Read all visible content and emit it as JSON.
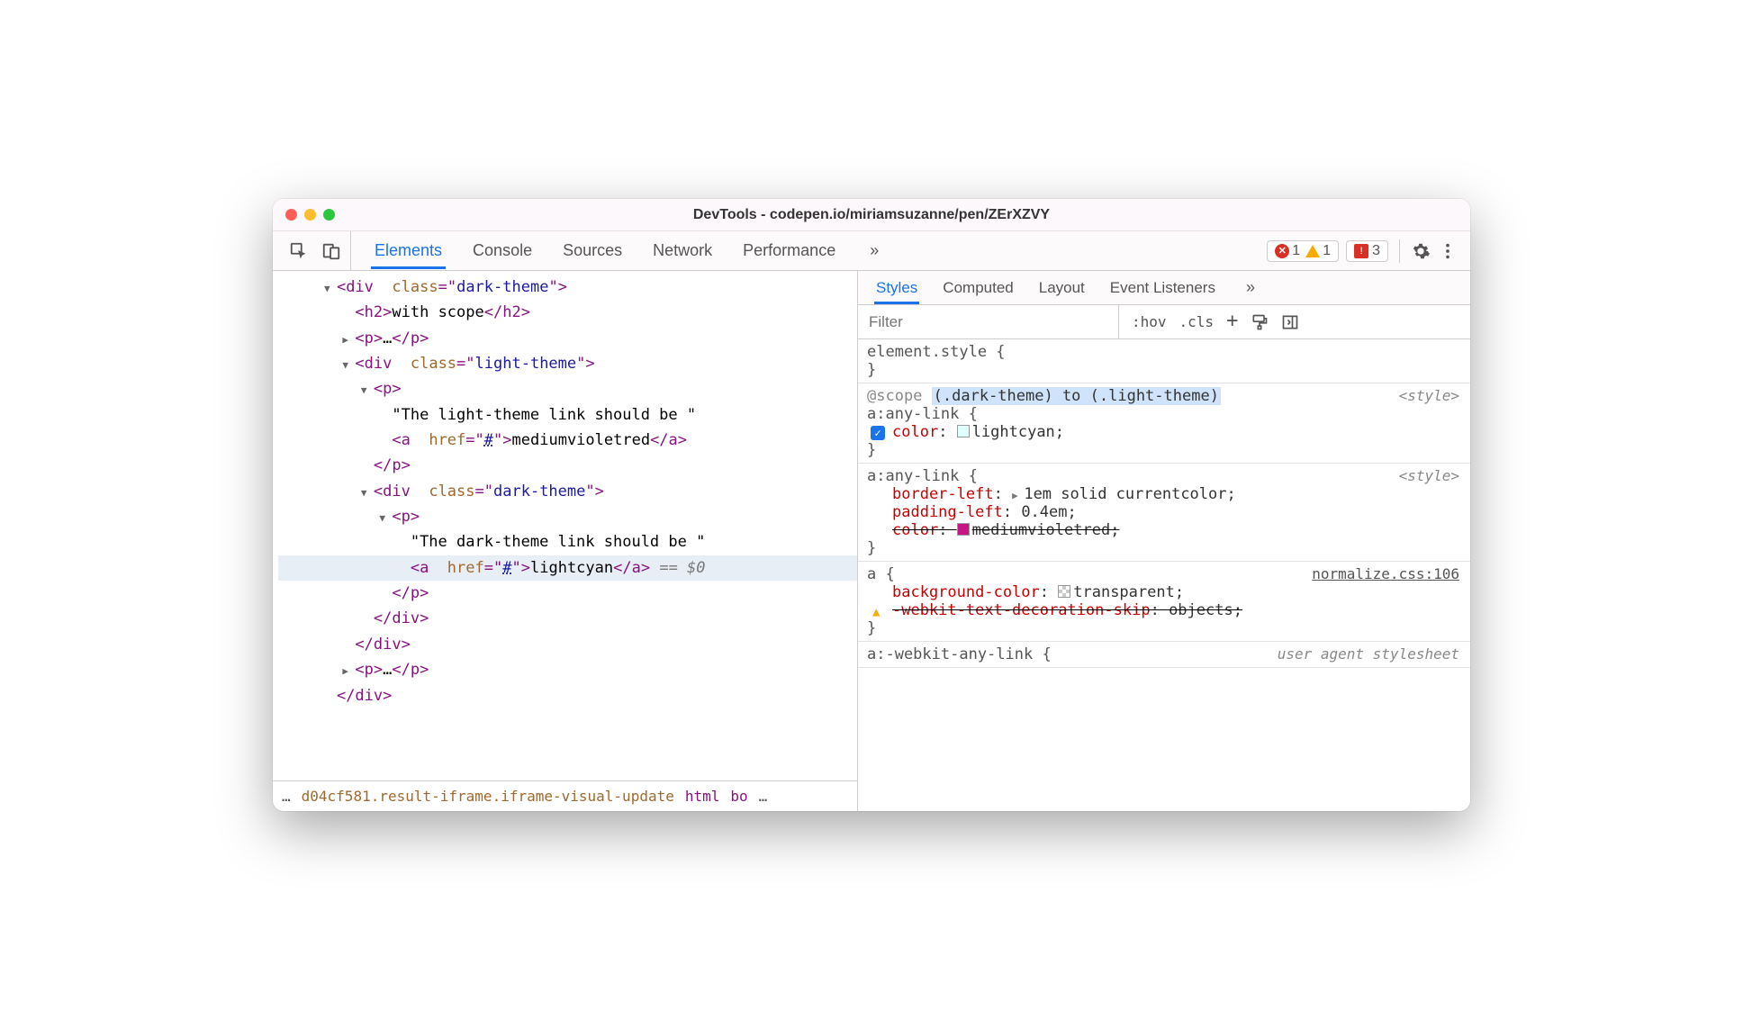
{
  "window": {
    "title": "DevTools - codepen.io/miriamsuzanne/pen/ZErXZVY"
  },
  "toolbar": {
    "tabs": [
      "Elements",
      "Console",
      "Sources",
      "Network",
      "Performance"
    ],
    "activeTab": "Elements",
    "more": "»",
    "errors": "1",
    "warnings": "1",
    "issues": "3"
  },
  "dom": {
    "lines": [
      {
        "indent": 2,
        "tri": "open",
        "html": "<div class=\"dark-theme\">"
      },
      {
        "indent": 3,
        "tri": "",
        "html": "<h2>with scope</h2>"
      },
      {
        "indent": 3,
        "tri": "closed",
        "html": "<p>…</p>"
      },
      {
        "indent": 3,
        "tri": "open",
        "html": "<div class=\"light-theme\">"
      },
      {
        "indent": 4,
        "tri": "open",
        "html": "<p>"
      },
      {
        "indent": 5,
        "tri": "",
        "text": "\"The light-theme link should be \""
      },
      {
        "indent": 5,
        "tri": "",
        "html": "<a href=\"#\">mediumvioletred</a>"
      },
      {
        "indent": 4,
        "tri": "",
        "html": "</p>"
      },
      {
        "indent": 4,
        "tri": "open",
        "html": "<div class=\"dark-theme\">"
      },
      {
        "indent": 5,
        "tri": "open",
        "html": "<p>"
      },
      {
        "indent": 6,
        "tri": "",
        "text": "\"The dark-theme link should be \""
      },
      {
        "indent": 6,
        "tri": "",
        "selected": true,
        "html": "<a href=\"#\">lightcyan</a>",
        "suffix": " == $0"
      },
      {
        "indent": 5,
        "tri": "",
        "html": "</p>"
      },
      {
        "indent": 4,
        "tri": "",
        "html": "</div>"
      },
      {
        "indent": 3,
        "tri": "",
        "html": "</div>"
      },
      {
        "indent": 3,
        "tri": "closed",
        "html": "<p>…</p>"
      },
      {
        "indent": 2,
        "tri": "",
        "html": "</div>"
      }
    ]
  },
  "breadcrumb": {
    "ellipsis": "…",
    "id": "d04cf581.result-iframe.iframe-visual-update",
    "items": [
      "html",
      "bo"
    ],
    "trailing": "…"
  },
  "sidebar": {
    "tabs": [
      "Styles",
      "Computed",
      "Layout",
      "Event Listeners"
    ],
    "activeTab": "Styles",
    "more": "»",
    "filterPlaceholder": "Filter",
    "tools": {
      "hov": ":hov",
      "cls": ".cls"
    }
  },
  "styles": {
    "rules": [
      {
        "selector": "element.style {",
        "close": "}",
        "props": []
      },
      {
        "scopePre": "@scope ",
        "scopeHl": "(.dark-theme) to (.light-theme)",
        "selector": "a:any-link {",
        "src": "<style>",
        "props": [
          {
            "checked": true,
            "name": "color",
            "swatch": "lightcyan",
            "value": "lightcyan;"
          }
        ],
        "close": "}"
      },
      {
        "selector": "a:any-link {",
        "src": "<style>",
        "props": [
          {
            "name": "border-left",
            "triangle": true,
            "value": "1em solid currentcolor;"
          },
          {
            "name": "padding-left",
            "value": "0.4em;"
          },
          {
            "name": "color",
            "swatch": "mvr",
            "value": "mediumvioletred;",
            "strike": true
          }
        ],
        "close": "}"
      },
      {
        "selector": "a {",
        "src": "normalize.css:106",
        "srcLink": true,
        "props": [
          {
            "name": "background-color",
            "swatch": "trans",
            "value": "transparent;"
          },
          {
            "name": "-webkit-text-decoration-skip",
            "value": "objects;",
            "strike": true,
            "warn": true
          }
        ],
        "close": "}"
      },
      {
        "selector": "a:-webkit-any-link {",
        "src": "user agent stylesheet",
        "props": []
      }
    ]
  }
}
